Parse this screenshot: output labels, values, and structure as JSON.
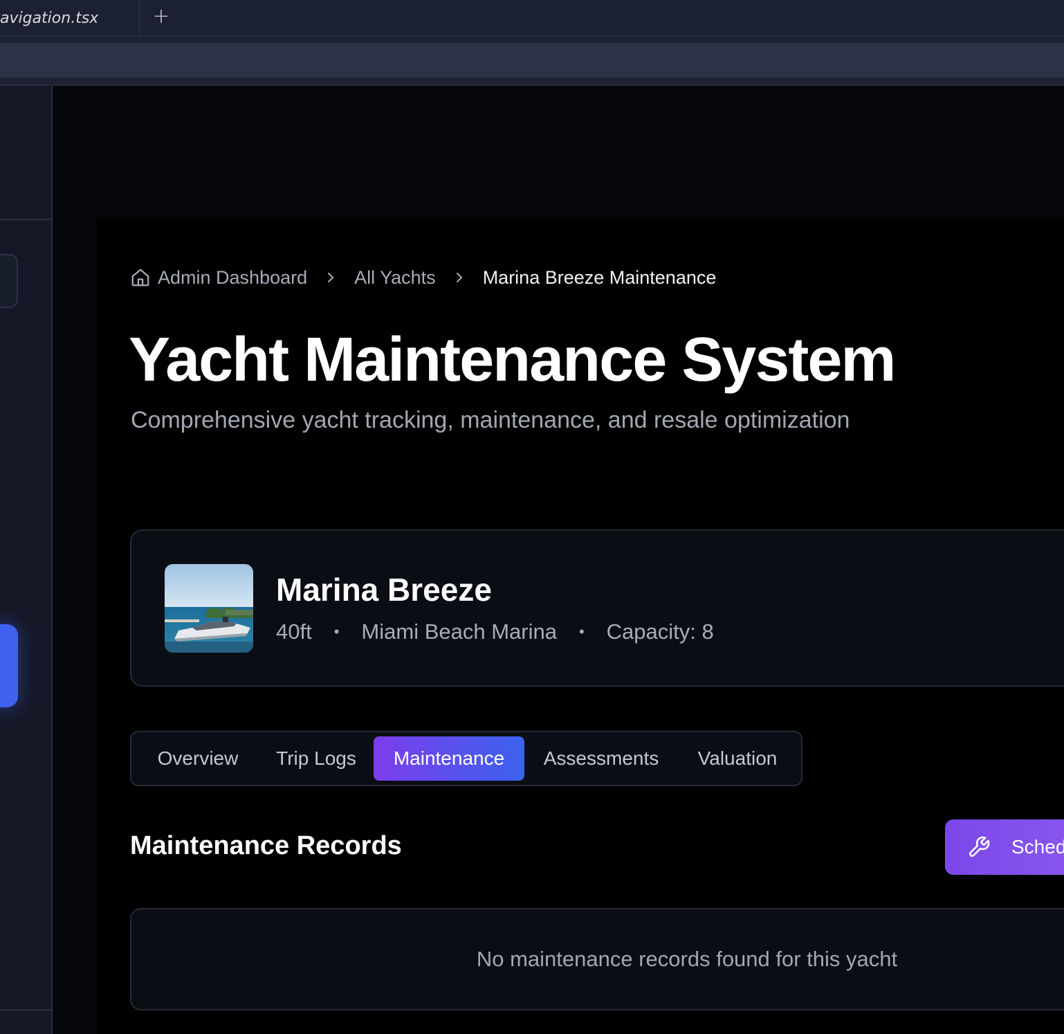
{
  "editor": {
    "tab_filename": "avigation.tsx",
    "new_tab_symbol": "+"
  },
  "breadcrumb": {
    "items": [
      "Admin Dashboard",
      "All Yachts"
    ],
    "current": "Marina Breeze Maintenance"
  },
  "page": {
    "title": "Yacht Maintenance System",
    "subtitle": "Comprehensive yacht tracking, maintenance, and resale optimization"
  },
  "yacht": {
    "name": "Marina Breeze",
    "length": "40ft",
    "marina": "Miami Beach Marina",
    "capacity": "Capacity: 8",
    "separator": "•"
  },
  "tabs": {
    "items": [
      "Overview",
      "Trip Logs",
      "Maintenance",
      "Assessments",
      "Valuation"
    ],
    "active": "Maintenance"
  },
  "records": {
    "title": "Maintenance Records",
    "schedule_button_label": "Schedule Maintenance",
    "empty_message": "No maintenance records found for this yacht"
  },
  "colors": {
    "accent_purple": "#7c3ded",
    "accent_blue": "#3c62ee",
    "background": "#000000"
  },
  "icons": [
    "home-icon",
    "chevron-right-icon",
    "wrench-icon"
  ]
}
